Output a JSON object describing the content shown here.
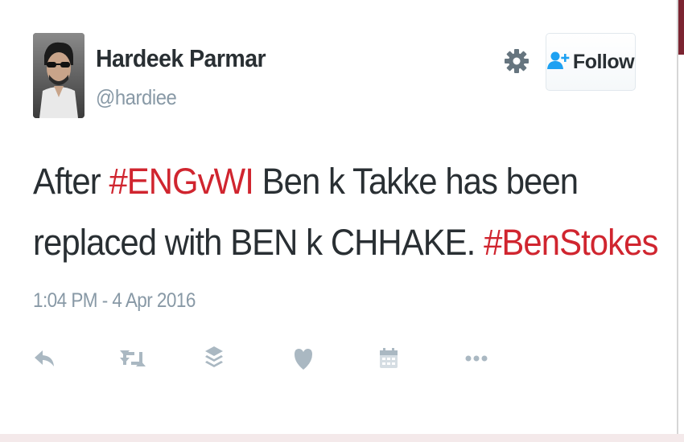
{
  "tweet": {
    "author": {
      "display_name": "Hardeek Parmar",
      "handle": "@hardiee",
      "avatar_icon": "profile-photo"
    },
    "text": {
      "line1": [
        {
          "text": "After ",
          "kind": "plain"
        },
        {
          "text": "#ENGvWI",
          "kind": "hashtag"
        },
        {
          "text": " Ben k Takke has been",
          "kind": "plain"
        }
      ],
      "line2": [
        {
          "text": "replaced with BEN k CHHAKE. ",
          "kind": "plain"
        },
        {
          "text": "#BenStokes",
          "kind": "hashtag"
        }
      ]
    },
    "timestamp": "1:04 PM - 4 Apr 2016",
    "follow_label": "Follow",
    "icons": {
      "settings": "gear-icon",
      "follow": "add-user-icon",
      "actions": [
        "reply-icon",
        "retweet-icon",
        "buffer-icon",
        "like-icon",
        "calendar-icon",
        "more-icon"
      ]
    }
  },
  "colors": {
    "text": "#292f33",
    "muted": "#8899a6",
    "hashtag": "#d0252f",
    "follow_icon": "#1da1f2",
    "action_icon": "#aab8c2",
    "accent_strip": "#7b2431"
  }
}
